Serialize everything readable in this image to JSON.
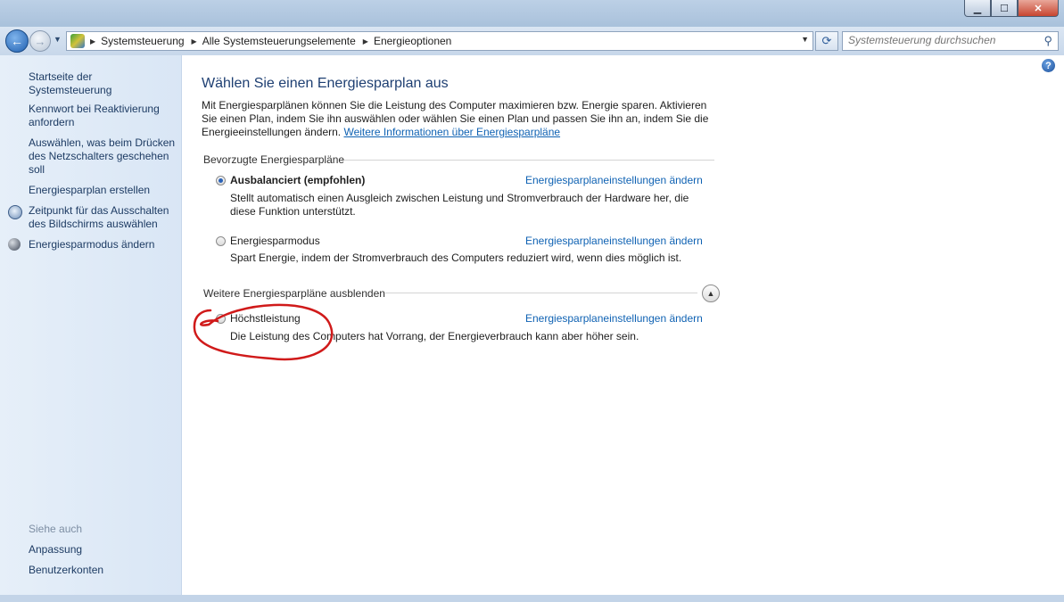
{
  "window": {
    "minimize_glyph": "▁",
    "maximize_glyph": "☐",
    "close_glyph": "✕"
  },
  "nav": {
    "back_glyph": "←",
    "forward_glyph": "→",
    "recent_glyph": "▼",
    "breadcrumbs": [
      "Systemsteuerung",
      "Alle Systemsteuerungselemente",
      "Energieoptionen"
    ],
    "crumb_separator": "▶",
    "dropdown_glyph": "▼",
    "refresh_glyph": "⟳",
    "search_placeholder": "Systemsteuerung durchsuchen",
    "search_glyph": "⚲"
  },
  "sidebar": {
    "links": [
      {
        "label": "Startseite der Systemsteuerung"
      },
      {
        "label": "Kennwort bei Reaktivierung anfordern"
      },
      {
        "label": "Auswählen, was beim Drücken des Netzschalters geschehen soll"
      },
      {
        "label": "Energiesparplan erstellen"
      },
      {
        "label": "Zeitpunkt für das Ausschalten des Bildschirms auswählen",
        "icon": "clock-monitor-icon"
      },
      {
        "label": "Energiesparmodus ändern",
        "icon": "moon-icon"
      }
    ],
    "see_also_heading": "Siehe auch",
    "see_also": [
      {
        "label": "Anpassung"
      },
      {
        "label": "Benutzerkonten"
      }
    ]
  },
  "main": {
    "help_glyph": "?",
    "title": "Wählen Sie einen Energiesparplan aus",
    "intro_text": "Mit Energiesparplänen können Sie die Leistung des Computer maximieren bzw. Energie sparen. Aktivieren Sie einen Plan, indem Sie ihn auswählen oder wählen Sie einen Plan und passen Sie ihn an, indem Sie die Energieeinstellungen ändern.",
    "intro_link": "Weitere Informationen über Energiesparpläne",
    "preferred_heading": "Bevorzugte Energiesparpläne",
    "more_heading": "Weitere Energiesparpläne ausblenden",
    "collapse_glyph": "▲",
    "plans": [
      {
        "name": "Ausbalanciert (empfohlen)",
        "selected": true,
        "description": "Stellt automatisch einen Ausgleich zwischen Leistung und Stromverbrauch der Hardware her, die diese Funktion unterstützt.",
        "link": "Energiesparplaneinstellungen ändern"
      },
      {
        "name": "Energiesparmodus",
        "selected": false,
        "description": "Spart Energie, indem der Stromverbrauch des Computers reduziert wird, wenn dies möglich ist.",
        "link": "Energiesparplaneinstellungen ändern"
      },
      {
        "name": "Höchstleistung",
        "selected": false,
        "description": "Die Leistung des Computers hat Vorrang, der Energieverbrauch kann aber höher sein.",
        "link": "Energiesparplaneinstellungen ändern"
      }
    ],
    "annotation_color": "#d01a1a"
  }
}
